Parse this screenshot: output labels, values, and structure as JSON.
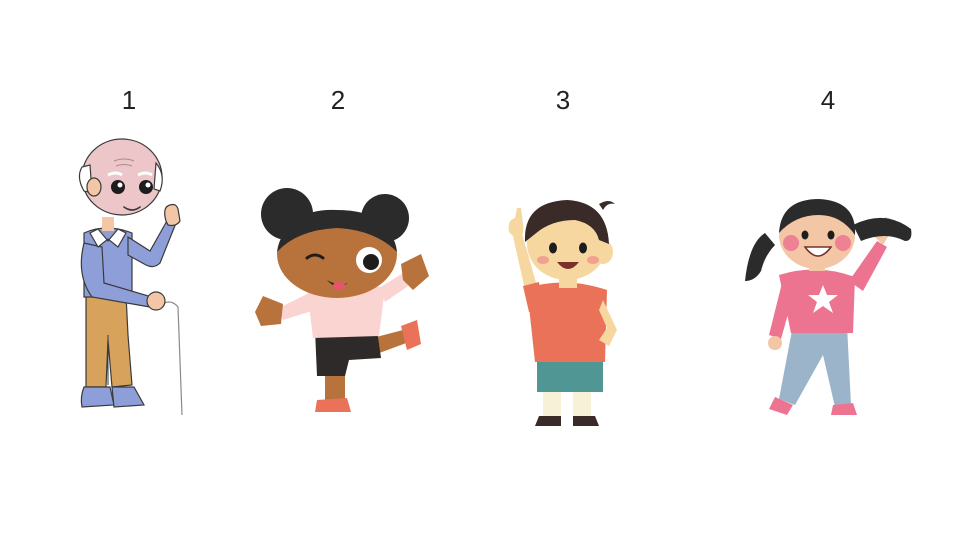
{
  "labels": [
    "1",
    "2",
    "3",
    "4"
  ],
  "figures": [
    {
      "icon": "elderly-man-with-cane-icon"
    },
    {
      "icon": "girl-with-buns-dancing-icon"
    },
    {
      "icon": "boy-pointing-up-icon"
    },
    {
      "icon": "girl-with-pigtails-waving-icon"
    }
  ],
  "colors": {
    "background": "#ffffff",
    "text": "#222222",
    "skin_light": "#f3c6a5",
    "skin_dark": "#b8733d",
    "hair_dark": "#2b2b2b",
    "sweater_blue": "#8e9ed8",
    "pants_tan": "#d7a25c",
    "shirt_pink": "#f9d4d1",
    "shirt_orange": "#ea7258",
    "shorts_teal": "#4f9694",
    "top_pink": "#ec7491",
    "jeans_blue": "#9cb4c9"
  }
}
